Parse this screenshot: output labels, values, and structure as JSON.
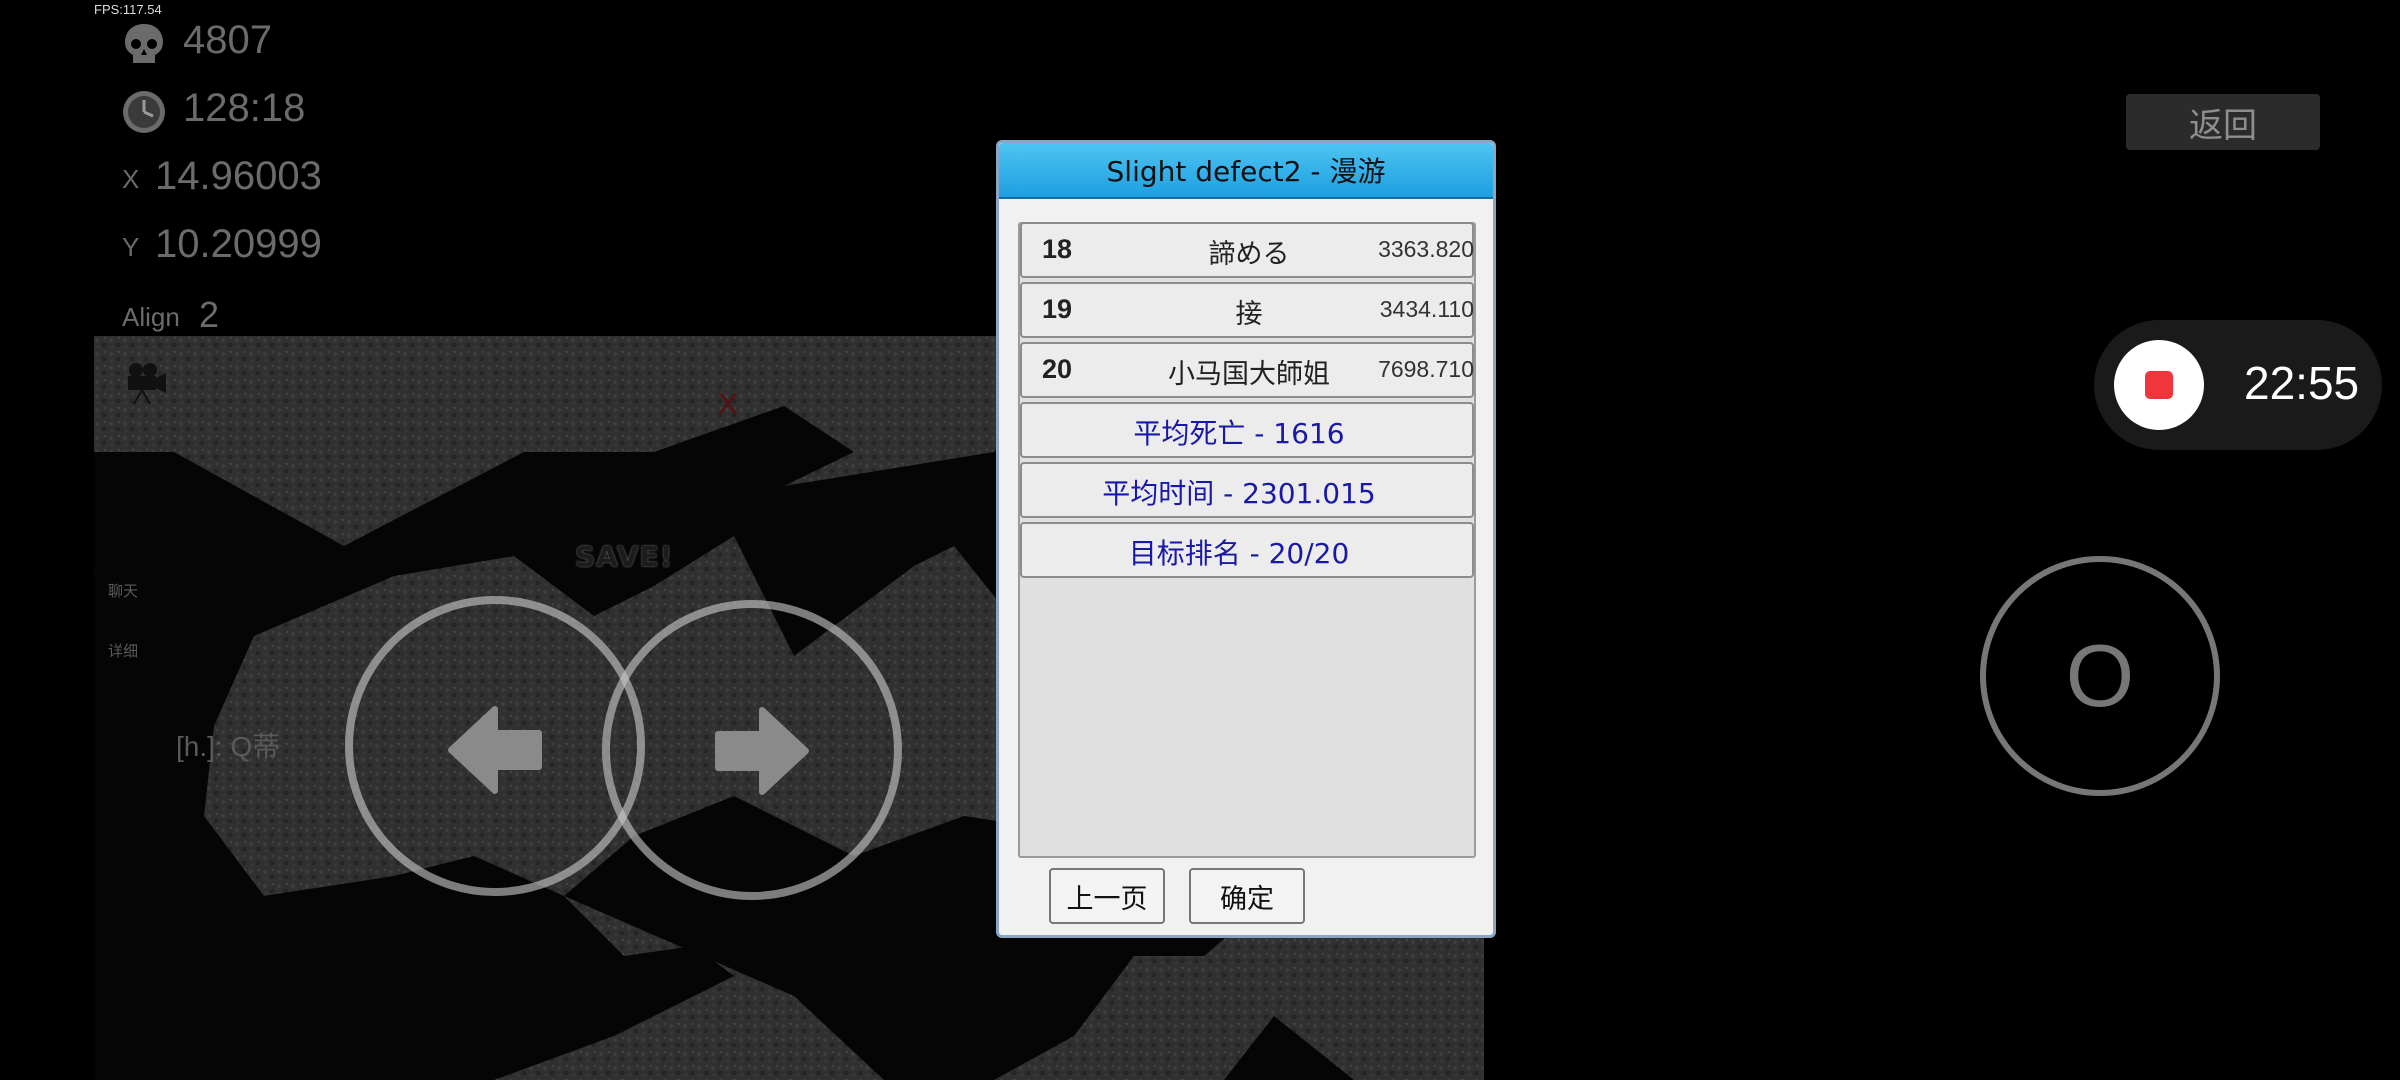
{
  "fps": "FPS:117.54",
  "stats": {
    "deaths": "4807",
    "time": "128:18",
    "x_label": "X",
    "x_value": "14.96003",
    "y_label": "Y",
    "y_value": "10.20999",
    "align_label": "Align",
    "align_value": "2"
  },
  "side_links": {
    "chat": "聊天",
    "detail": "详细"
  },
  "chat_message": "[h.]: Q蒂",
  "save_text": "SAVE!",
  "marker_text": "X",
  "back_button": "返回",
  "recording": {
    "time": "22:55",
    "stop_color": "#f0353c"
  },
  "action_button": "O",
  "dialog": {
    "title": "Slight defect2 - 漫游",
    "entries": [
      {
        "rank": "18",
        "name": "諦める",
        "time": "3363.820"
      },
      {
        "rank": "19",
        "name": "接",
        "time": "3434.110"
      },
      {
        "rank": "20",
        "name": "小马国大師姐",
        "time": "7698.710"
      }
    ],
    "summaries": [
      "平均死亡 - 1616",
      "平均时间 - 2301.015",
      "目标排名 - 20/20"
    ],
    "prev_button": "上一页",
    "ok_button": "确定"
  },
  "colors": {
    "title_bar": "#1e9fe0",
    "summary_text": "#1919a8",
    "background": "#000000"
  }
}
